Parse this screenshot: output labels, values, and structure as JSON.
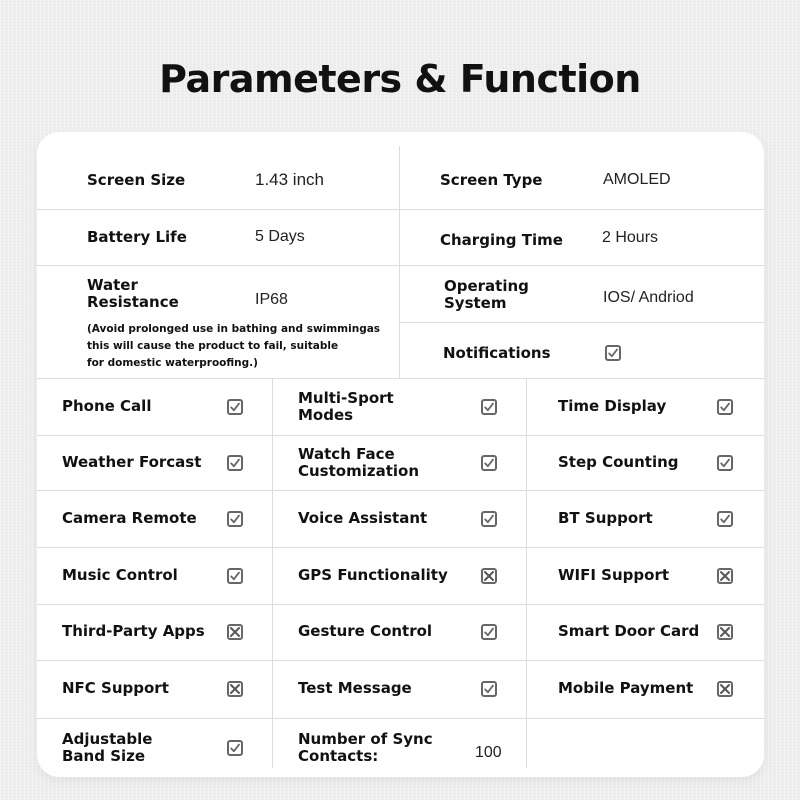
{
  "title": "Parameters & Function",
  "params": {
    "screen_size": {
      "label": "Screen Size",
      "value": "1.43 inch"
    },
    "screen_type": {
      "label": "Screen Type",
      "value": "AMOLED"
    },
    "battery_life": {
      "label": "Battery Life",
      "value": "5 Days"
    },
    "charging_time": {
      "label": "Charging Time",
      "value": "2 Hours"
    },
    "water_resistance": {
      "label": "Water\nResistance",
      "value": "IP68",
      "note": "(Avoid prolonged use in bathing and swimmingas\nthis will cause the product to fail, suitable\nfor domestic waterproofing.)"
    },
    "operating_system": {
      "label": "Operating\nSystem",
      "value": "IOS/ Andriod"
    },
    "notifications": {
      "label": "Notifications",
      "supported": true
    }
  },
  "features": [
    [
      {
        "label": "Phone Call",
        "supported": true
      },
      {
        "label": "Multi-Sport\nModes",
        "supported": true
      },
      {
        "label": "Time Display",
        "supported": true
      }
    ],
    [
      {
        "label": "Weather Forcast",
        "supported": true
      },
      {
        "label": "Watch Face\nCustomization",
        "supported": true
      },
      {
        "label": "Step Counting",
        "supported": true
      }
    ],
    [
      {
        "label": "Camera Remote",
        "supported": true
      },
      {
        "label": "Voice Assistant",
        "supported": true
      },
      {
        "label": "BT Support",
        "supported": true
      }
    ],
    [
      {
        "label": "Music Control",
        "supported": true
      },
      {
        "label": "GPS Functionality",
        "supported": false
      },
      {
        "label": "WIFI Support",
        "supported": false
      }
    ],
    [
      {
        "label": "Third-Party Apps",
        "supported": false
      },
      {
        "label": "Gesture Control",
        "supported": true
      },
      {
        "label": "Smart Door Card",
        "supported": false
      }
    ],
    [
      {
        "label": "NFC Support",
        "supported": false
      },
      {
        "label": "Test Message",
        "supported": true
      },
      {
        "label": "Mobile Payment",
        "supported": false
      }
    ],
    [
      {
        "label": "Adjustable\nBand Size",
        "supported": true
      },
      {
        "label": "Number of Sync\nContacts:",
        "value": "100"
      }
    ]
  ],
  "icons": {
    "supported": "checkmark-icon",
    "unsupported": "cross-icon"
  },
  "colors": {
    "background": "#eeeeee",
    "card": "#ffffff",
    "text": "#111111",
    "grid": "#dcdcdc",
    "checkbox_border": "#666666"
  }
}
